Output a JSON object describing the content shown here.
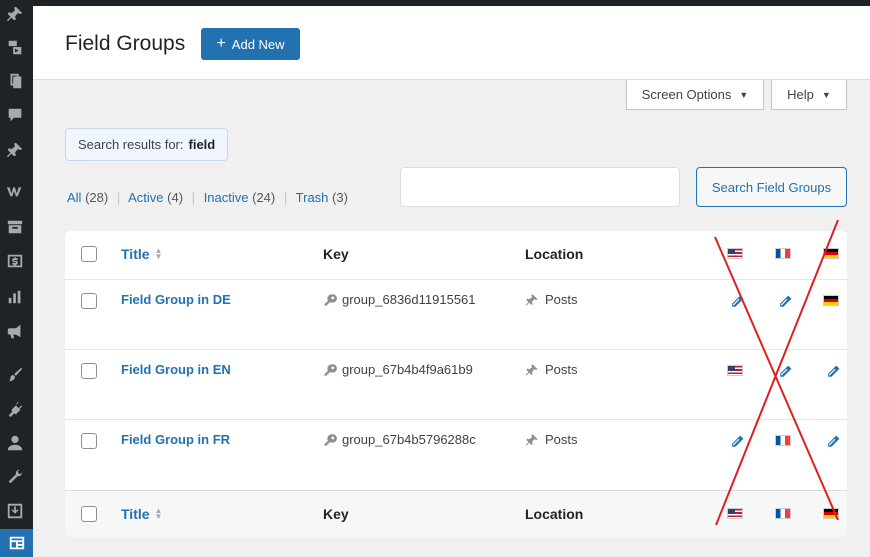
{
  "header": {
    "title": "Field Groups",
    "add_new_label": "Add New"
  },
  "screen_options": {
    "label": "Screen Options"
  },
  "help": {
    "label": "Help"
  },
  "search_summary": {
    "prefix": "Search results for:",
    "term": "field"
  },
  "filters": [
    {
      "label": "All",
      "count": "(28)"
    },
    {
      "label": "Active",
      "count": "(4)"
    },
    {
      "label": "Inactive",
      "count": "(24)"
    },
    {
      "label": "Trash",
      "count": "(3)"
    }
  ],
  "search": {
    "value": "",
    "button_label": "Search Field Groups"
  },
  "table": {
    "columns": {
      "title": "Title",
      "key": "Key",
      "location": "Location"
    },
    "languages": [
      "en-us",
      "fr",
      "de"
    ],
    "rows": [
      {
        "title": "Field Group in DE",
        "key": "group_6836d11915561",
        "location": "Posts",
        "langs": [
          "edit",
          "edit",
          "flag"
        ]
      },
      {
        "title": "Field Group in EN",
        "key": "group_67b4b4f9a61b9",
        "location": "Posts",
        "langs": [
          "flag",
          "edit",
          "edit"
        ]
      },
      {
        "title": "Field Group in FR",
        "key": "group_67b4b5796288c",
        "location": "Posts",
        "langs": [
          "edit",
          "flag",
          "edit"
        ]
      }
    ]
  },
  "colors": {
    "accent": "#2271b1",
    "sidebar": "#1d2327",
    "cross": "#e02020"
  },
  "sidebar_icons": [
    "pin-icon",
    "media-icon",
    "pages-icon",
    "comments-icon",
    "pin-icon",
    "woo-icon",
    "archive-icon",
    "payments-icon",
    "analytics-icon",
    "marketing-icon",
    "brush-icon",
    "plugins-icon",
    "users-icon",
    "tools-icon",
    "import-icon",
    "acf-icon"
  ]
}
